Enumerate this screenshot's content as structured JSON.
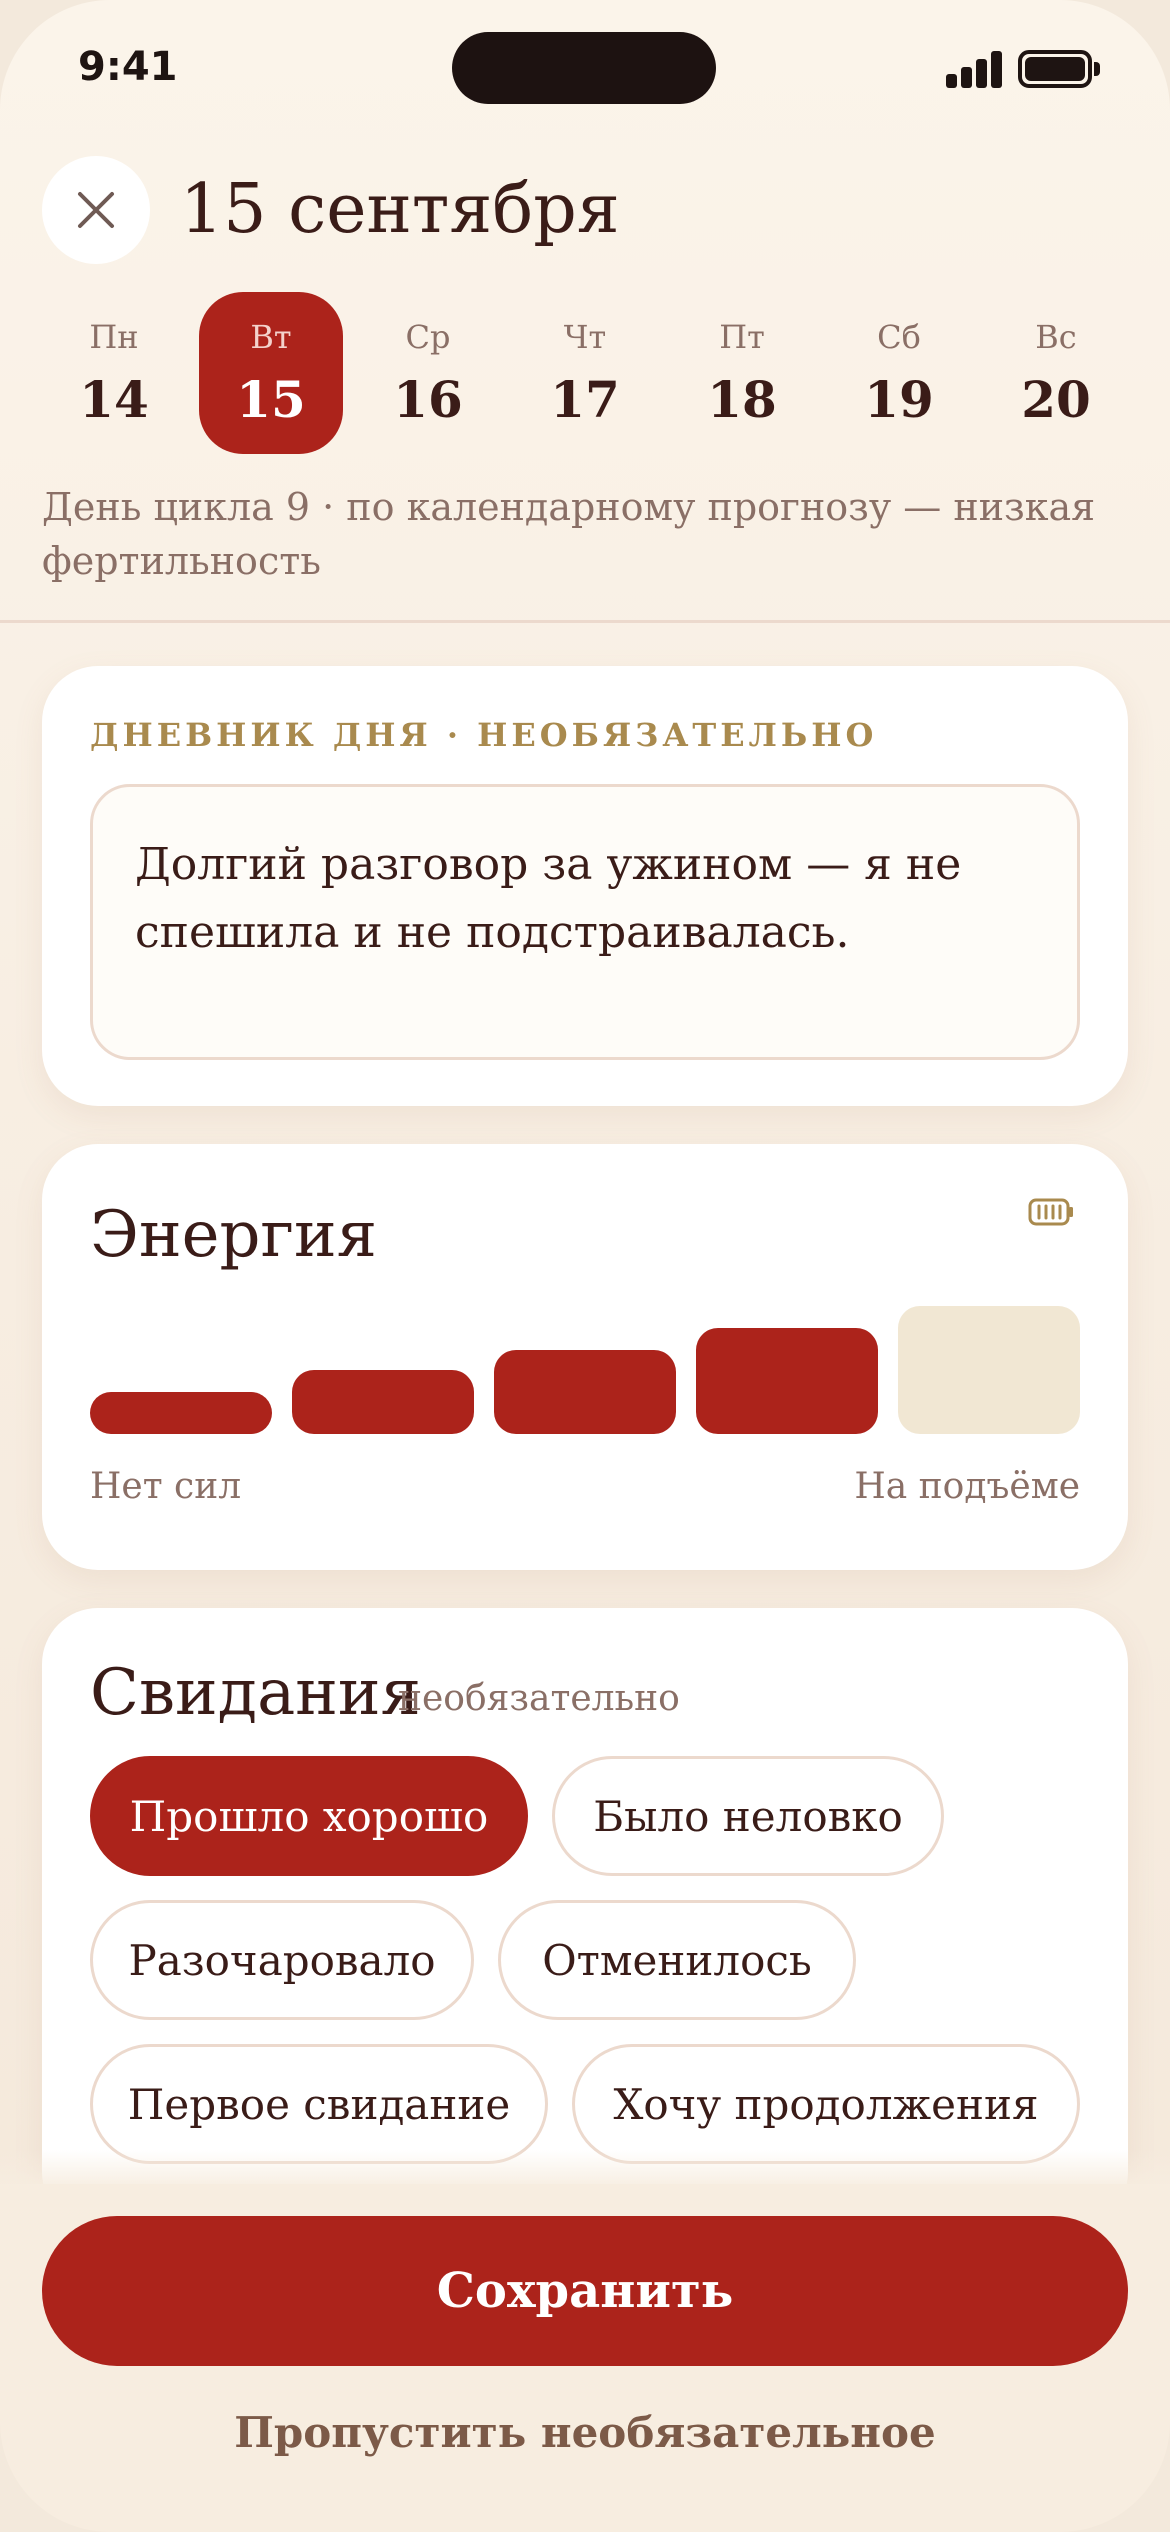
{
  "status": {
    "time": "9:41"
  },
  "header": {
    "title": "15 сентября"
  },
  "week": {
    "days": [
      {
        "name": "Пн",
        "num": "14"
      },
      {
        "name": "Вт",
        "num": "15"
      },
      {
        "name": "Ср",
        "num": "16"
      },
      {
        "name": "Чт",
        "num": "17"
      },
      {
        "name": "Пт",
        "num": "18"
      },
      {
        "name": "Сб",
        "num": "19"
      },
      {
        "name": "Вс",
        "num": "20"
      }
    ],
    "selected": "15"
  },
  "cycle_note": "День цикла 9 · по календарному прогнозу — низкая фертильность",
  "journal": {
    "eyebrow": "ДНЕВНИК ДНЯ · НЕОБЯЗАТЕЛЬНО",
    "text": "Долгий разговор за ужином — я не спешила и не подстраивалась."
  },
  "energy": {
    "title": "Энергия",
    "icon": "battery-icon",
    "level": 4,
    "max": 5,
    "scale_min_label": "Нет сил",
    "scale_max_label": "На подъёме"
  },
  "dates": {
    "title": "Свидания",
    "optional_label": "необязательно",
    "chips": [
      {
        "label": "Прошло хорошо",
        "selected": true
      },
      {
        "label": "Было неловко",
        "selected": false
      },
      {
        "label": "Разочаровало",
        "selected": false
      },
      {
        "label": "Отменилось",
        "selected": false
      },
      {
        "label": "Первое свидание",
        "selected": false
      },
      {
        "label": "Хочу продолжения",
        "selected": false
      }
    ]
  },
  "actions": {
    "save_label": "Сохранить",
    "skip_label": "Пропустить необязательное"
  },
  "colors": {
    "accent": "#ac231b",
    "energy_empty": "#f1e7d3",
    "eyebrow": "#a98a4e",
    "background": "#f7ede1"
  }
}
